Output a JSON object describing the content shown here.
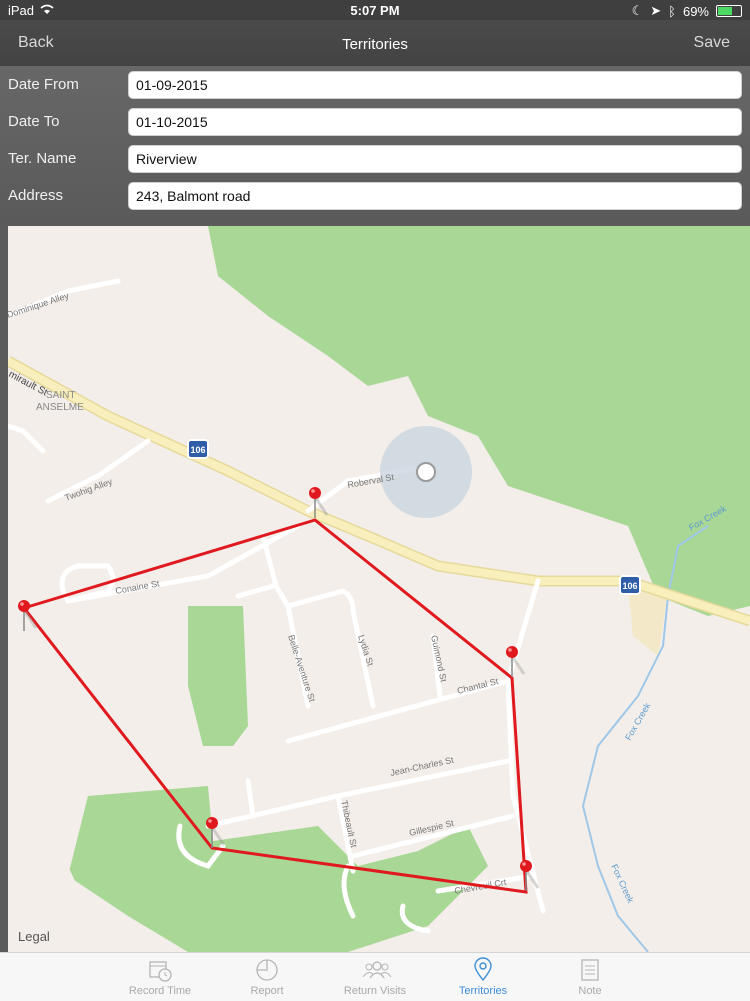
{
  "status": {
    "device": "iPad",
    "time": "5:07 PM",
    "battery": "69%",
    "battery_level": 0.69
  },
  "nav": {
    "back": "Back",
    "title": "Territories",
    "save": "Save"
  },
  "form": {
    "date_from": {
      "label": "Date From",
      "value": "01-09-2015"
    },
    "date_to": {
      "label": "Date To",
      "value": "01-10-2015"
    },
    "ter_name": {
      "label": "Ter. Name",
      "value": "Riverview"
    },
    "address": {
      "label": "Address",
      "value": "243, Balmont road"
    }
  },
  "map": {
    "legal": "Legal",
    "labels": {
      "dominique": "Dominique Alley",
      "amirault": "mirault St",
      "saint": "SAINT",
      "anselme": "ANSELME",
      "twohig": "Twohig Alley",
      "roberval": "Roberval St",
      "fox1": "Fox Creek",
      "fox2": "Fox Creek",
      "fox3": "Fox Creek",
      "route1": "106",
      "route2": "106",
      "conaine": "Conaine St",
      "belle": "Belle-Aventure St",
      "lydia": "Lydia St",
      "guimond": "Guimond St",
      "chantal": "Chantal St",
      "jean": "Jean-Charles St",
      "thibeault": "Thibeault St",
      "gillespie": "Gillespie St",
      "chevreuil": "Chevreuil Crt"
    },
    "colors": {
      "polygon": "#e0191f",
      "park": "#a8d796",
      "road": "#ffffff",
      "highway": "#f5e9a8"
    }
  },
  "tabs": [
    {
      "label": "Record Time",
      "icon": "calendar-clock-icon"
    },
    {
      "label": "Report",
      "icon": "pie-chart-icon"
    },
    {
      "label": "Return Visits",
      "icon": "people-icon"
    },
    {
      "label": "Territories",
      "icon": "map-pin-icon",
      "active": true
    },
    {
      "label": "Note",
      "icon": "note-icon"
    }
  ]
}
